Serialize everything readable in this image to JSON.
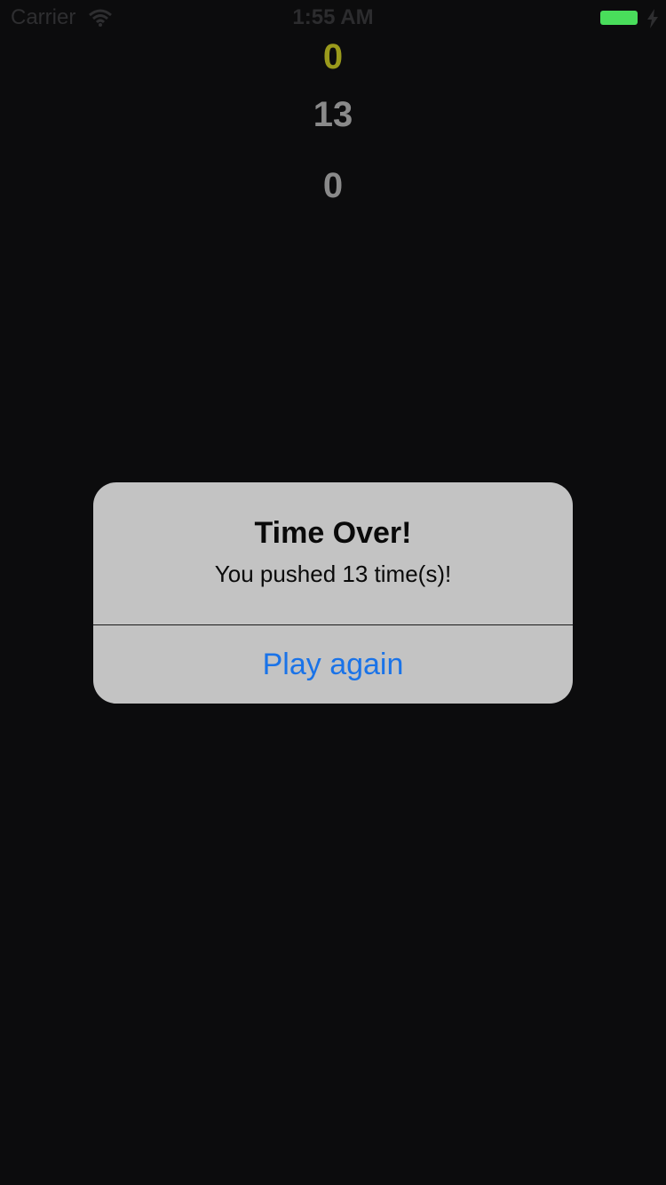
{
  "status_bar": {
    "carrier": "Carrier",
    "time": "1:55 AM",
    "battery_color": "#49dd5b"
  },
  "counters": {
    "top_value": "0",
    "top_color": "#9a9a1c",
    "middle_value": "13",
    "middle_color": "#8a8a8a",
    "bottom_value": "0",
    "bottom_color": "#8a8a8a"
  },
  "alert": {
    "title": "Time Over!",
    "message": "You pushed 13 time(s)!",
    "button_label": "Play again",
    "button_color": "#1a73e8"
  }
}
